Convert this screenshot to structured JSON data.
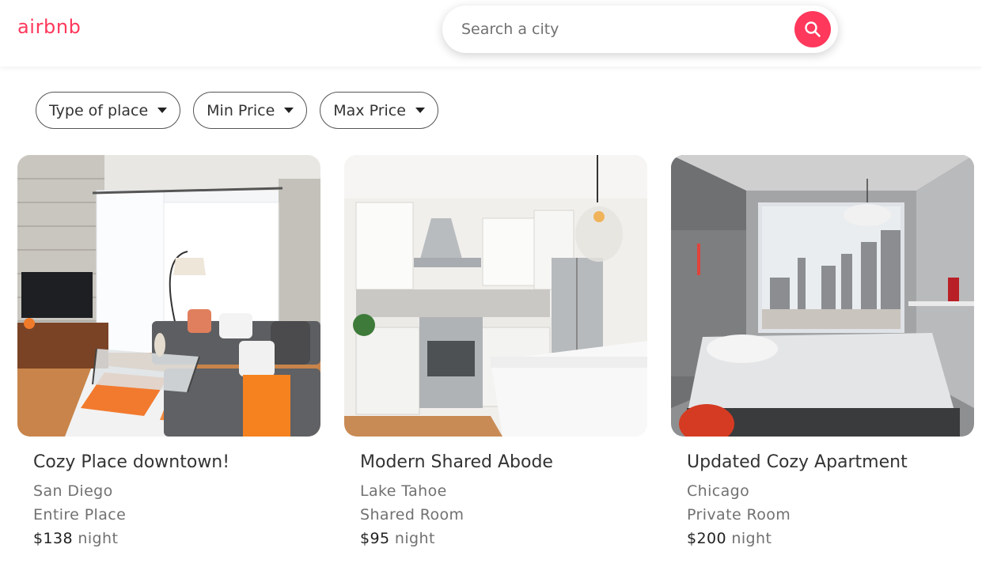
{
  "header": {
    "logo": "airbnb",
    "search": {
      "placeholder": "Search a city",
      "button_icon": "search-icon"
    },
    "brand_color": "#ff385c"
  },
  "filters": [
    {
      "label": "Type of place",
      "icon": "caret-down-icon"
    },
    {
      "label": "Min Price",
      "icon": "caret-down-icon"
    },
    {
      "label": "Max Price",
      "icon": "caret-down-icon"
    }
  ],
  "listings": [
    {
      "title": "Cozy Place downtown!",
      "city": "San Diego",
      "type": "Entire Place",
      "price": "$138",
      "unit": "night",
      "photo": "living-room-photo"
    },
    {
      "title": "Modern Shared Abode",
      "city": "Lake Tahoe",
      "type": "Shared Room",
      "price": "$95",
      "unit": "night",
      "photo": "kitchen-photo"
    },
    {
      "title": "Updated Cozy Apartment",
      "city": "Chicago",
      "type": "Private Room",
      "price": "$200",
      "unit": "night",
      "photo": "bedroom-photo"
    }
  ]
}
